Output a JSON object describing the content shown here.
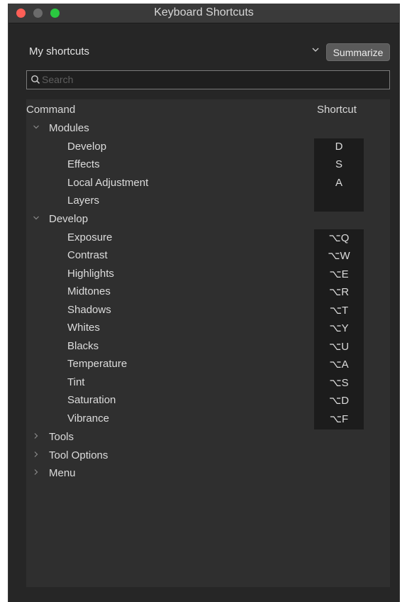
{
  "window": {
    "title": "Keyboard Shortcuts"
  },
  "preset": {
    "label": "My shortcuts",
    "chevron": "chevron-down-icon",
    "summarize_label": "Summarize"
  },
  "search": {
    "placeholder": "Search",
    "icon": "search-icon"
  },
  "table": {
    "col_command": "Command",
    "col_shortcut": "Shortcut",
    "groups": [
      {
        "label": "Modules",
        "expanded": true,
        "items": [
          {
            "label": "Develop",
            "key": "D"
          },
          {
            "label": "Effects",
            "key": "S"
          },
          {
            "label": "Local Adjustment",
            "key": "A"
          },
          {
            "label": "Layers",
            "key": ""
          }
        ]
      },
      {
        "label": "Develop",
        "expanded": true,
        "items": [
          {
            "label": "Exposure",
            "key": "⌥Q"
          },
          {
            "label": "Contrast",
            "key": "⌥W"
          },
          {
            "label": "Highlights",
            "key": "⌥E"
          },
          {
            "label": "Midtones",
            "key": "⌥R"
          },
          {
            "label": "Shadows",
            "key": "⌥T"
          },
          {
            "label": "Whites",
            "key": "⌥Y"
          },
          {
            "label": "Blacks",
            "key": "⌥U"
          },
          {
            "label": "Temperature",
            "key": "⌥A"
          },
          {
            "label": "Tint",
            "key": "⌥S"
          },
          {
            "label": "Saturation",
            "key": "⌥D"
          },
          {
            "label": "Vibrance",
            "key": "⌥F"
          }
        ]
      },
      {
        "label": "Tools",
        "expanded": false,
        "items": []
      },
      {
        "label": "Tool Options",
        "expanded": false,
        "items": []
      },
      {
        "label": "Menu",
        "expanded": false,
        "items": []
      }
    ]
  }
}
